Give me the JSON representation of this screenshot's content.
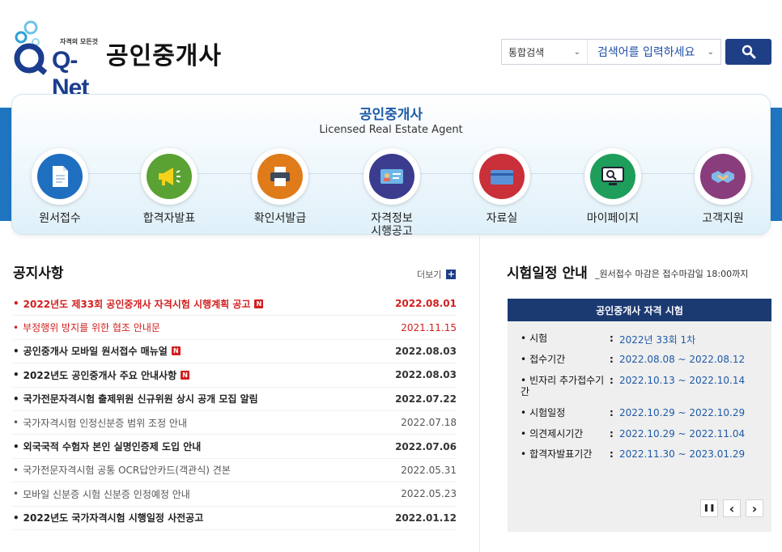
{
  "brand": {
    "logo_text": "Q-Net",
    "logo_tagline": "자격의 모든것",
    "site_title": "공인중개사"
  },
  "search": {
    "category": "통합검색",
    "placeholder": "검색어를 입력하세요"
  },
  "banner": {
    "title": "공인중개사",
    "subtitle": "Licensed Real Estate Agent",
    "menu": [
      {
        "label": "원서접수",
        "icon": "document-icon",
        "color": "#1f6fc0"
      },
      {
        "label": "합격자발표",
        "icon": "megaphone-icon",
        "color": "#5aa233"
      },
      {
        "label": "확인서발급",
        "icon": "printer-icon",
        "color": "#e07b1a"
      },
      {
        "label": "자격정보\n시행공고",
        "icon": "id-card-icon",
        "color": "#3b3c8e"
      },
      {
        "label": "자료실",
        "icon": "folder-icon",
        "color": "#c9303a"
      },
      {
        "label": "마이페이지",
        "icon": "monitor-icon",
        "color": "#1e9e5a"
      },
      {
        "label": "고객지원",
        "icon": "handshake-icon",
        "color": "#8a3d7c"
      }
    ]
  },
  "notice": {
    "title": "공지사항",
    "more_label": "더보기",
    "items": [
      {
        "title": "2022년도 제33회 공인중개사 자격시험 시행계획 공고",
        "date": "2022.08.01",
        "style": "red bold",
        "new": true
      },
      {
        "title": "부정행위 방지를 위한 협조 안내문",
        "date": "2021.11.15",
        "style": "red",
        "new": false
      },
      {
        "title": "공인중개사 모바일 원서접수 매뉴얼",
        "date": "2022.08.03",
        "style": "bold",
        "new": true
      },
      {
        "title": "2022년도 공인중개사 주요 안내사항",
        "date": "2022.08.03",
        "style": "bold",
        "new": true
      },
      {
        "title": "국가전문자격시험 출제위원 신규위원 상시 공개 모집 알림",
        "date": "2022.07.22",
        "style": "bold",
        "new": false
      },
      {
        "title": "국가자격시험 인정신분증 범위 조정 안내",
        "date": "2022.07.18",
        "style": "light",
        "new": false
      },
      {
        "title": "외국국적 수험자 본인 실명인증제 도입 안내",
        "date": "2022.07.06",
        "style": "bold",
        "new": false
      },
      {
        "title": "국가전문자격시험 공통 OCR답안카드(객관식) 견본",
        "date": "2022.05.31",
        "style": "light",
        "new": false
      },
      {
        "title": "모바일 신분증 시험 신분증 인정예정 안내",
        "date": "2022.05.23",
        "style": "light",
        "new": false
      },
      {
        "title": "2022년도 국가자격시험 시행일정 사전공고",
        "date": "2022.01.12",
        "style": "bold",
        "new": false
      }
    ],
    "new_badge": "N"
  },
  "schedule": {
    "title": "시험일정 안내",
    "note": "_원서접수 마감은 접수마감일 18:00까지",
    "box_title": "공인중개사 자격 시험",
    "rows": [
      {
        "label": "시험",
        "value": "2022년 33회 1차"
      },
      {
        "label": "접수기간",
        "value": "2022.08.08 ~ 2022.08.12"
      },
      {
        "label": "빈자리 추가접수기간",
        "value": "2022.10.13 ~ 2022.10.14"
      },
      {
        "label": "시험일정",
        "value": "2022.10.29 ~ 2022.10.29"
      },
      {
        "label": "의견제시기간",
        "value": "2022.10.29 ~ 2022.11.04"
      },
      {
        "label": "합격자발표기간",
        "value": "2022.11.30 ~ 2023.01.29"
      }
    ],
    "colon": ":",
    "controls": {
      "pause": "❚❚",
      "prev": "‹",
      "next": "›"
    }
  }
}
